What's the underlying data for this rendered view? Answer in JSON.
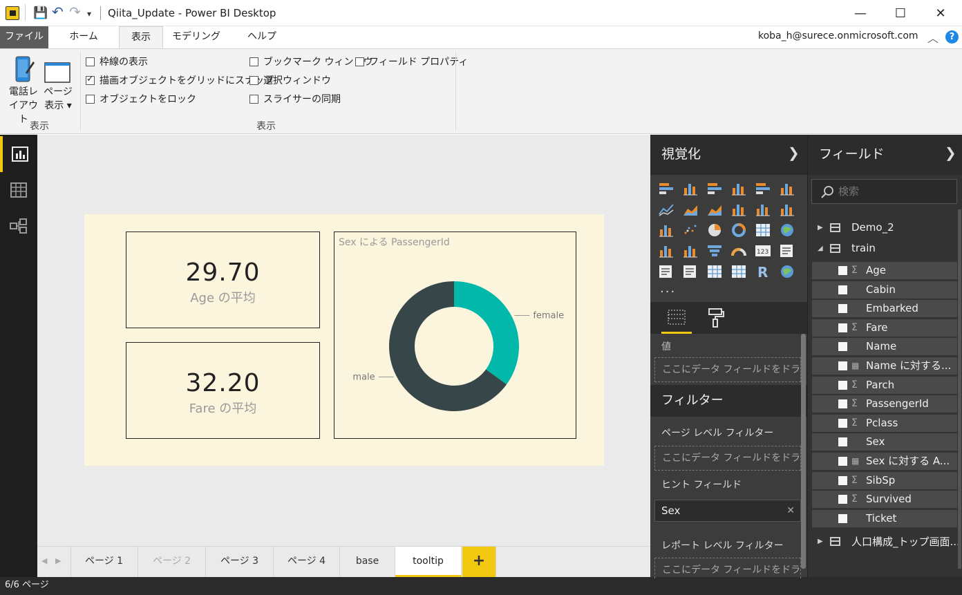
{
  "window": {
    "title": "Qiita_Update - Power BI Desktop",
    "minimize": "—",
    "maximize": "☐",
    "close": "✕"
  },
  "quick_access": {
    "save": "💾",
    "undo": "↶",
    "redo": "↷",
    "more": "▾"
  },
  "ribbon_tabs": [
    "ファイル",
    "ホーム",
    "表示",
    "モデリング",
    "ヘルプ"
  ],
  "active_tab": "表示",
  "account": "koba_h@surece.onmicrosoft.com",
  "ribbon": {
    "phone_layout": [
      "電話レ",
      "イアウト"
    ],
    "page_view": [
      "ページ",
      "表示 ▾"
    ],
    "group1_label": "表示",
    "group2_label": "表示",
    "checkboxes": [
      {
        "label": "枠線の表示",
        "checked": false
      },
      {
        "label": "描画オブジェクトをグリッドにスナップ",
        "checked": true
      },
      {
        "label": "オブジェクトをロック",
        "checked": false
      },
      {
        "label": "ブックマーク ウィンドウ",
        "checked": false
      },
      {
        "label": "選択ウィンドウ",
        "checked": false
      },
      {
        "label": "スライサーの同期",
        "checked": false
      },
      {
        "label": "フィールド プロパティ",
        "checked": false
      }
    ]
  },
  "report": {
    "card1": {
      "value": "29.70",
      "label": "Age の平均"
    },
    "card2": {
      "value": "32.20",
      "label": "Fare の平均"
    },
    "donut": {
      "title": "Sex による PassengerId",
      "slices": [
        {
          "name": "female",
          "share": 0.35,
          "color": "#01b8aa"
        },
        {
          "name": "male",
          "share": 0.65,
          "color": "#374649"
        }
      ]
    },
    "background_color": "#fcf5dd"
  },
  "page_tabs": [
    {
      "label": "ページ 1",
      "state": "normal"
    },
    {
      "label": "ページ 2",
      "state": "dim"
    },
    {
      "label": "ページ 3",
      "state": "normal"
    },
    {
      "label": "ページ 4",
      "state": "normal"
    },
    {
      "label": "base",
      "state": "normal"
    },
    {
      "label": "tooltip",
      "state": "selected"
    }
  ],
  "add_page": "+",
  "status": "6/6 ページ",
  "viz_pane": {
    "title": "視覚化",
    "more": "...",
    "values_label": "値",
    "drop_hint": "ここにデータ フィールドをドラッグ...",
    "filters_title": "フィルター",
    "page_level": "ページ レベル フィルター",
    "tooltip_fields": "ヒント フィールド",
    "tooltip_value": "Sex",
    "report_level": "レポート レベル フィルター"
  },
  "fields_pane": {
    "title": "フィールド",
    "search_placeholder": "検索",
    "tables": [
      {
        "name": "Demo_2",
        "expanded": false
      },
      {
        "name": "train",
        "expanded": true
      },
      {
        "name": "人口構成_トップ画面...",
        "expanded": false
      }
    ],
    "train_fields": [
      {
        "name": "Age",
        "icon": "sigma"
      },
      {
        "name": "Cabin",
        "icon": ""
      },
      {
        "name": "Embarked",
        "icon": ""
      },
      {
        "name": "Fare",
        "icon": "sigma"
      },
      {
        "name": "Name",
        "icon": ""
      },
      {
        "name": "Name に対する...",
        "icon": "calc"
      },
      {
        "name": "Parch",
        "icon": "sigma"
      },
      {
        "name": "PassengerId",
        "icon": "sigma"
      },
      {
        "name": "Pclass",
        "icon": "sigma"
      },
      {
        "name": "Sex",
        "icon": ""
      },
      {
        "name": "Sex に対する A...",
        "icon": "calc"
      },
      {
        "name": "SibSp",
        "icon": "sigma"
      },
      {
        "name": "Survived",
        "icon": "sigma"
      },
      {
        "name": "Ticket",
        "icon": ""
      }
    ]
  }
}
